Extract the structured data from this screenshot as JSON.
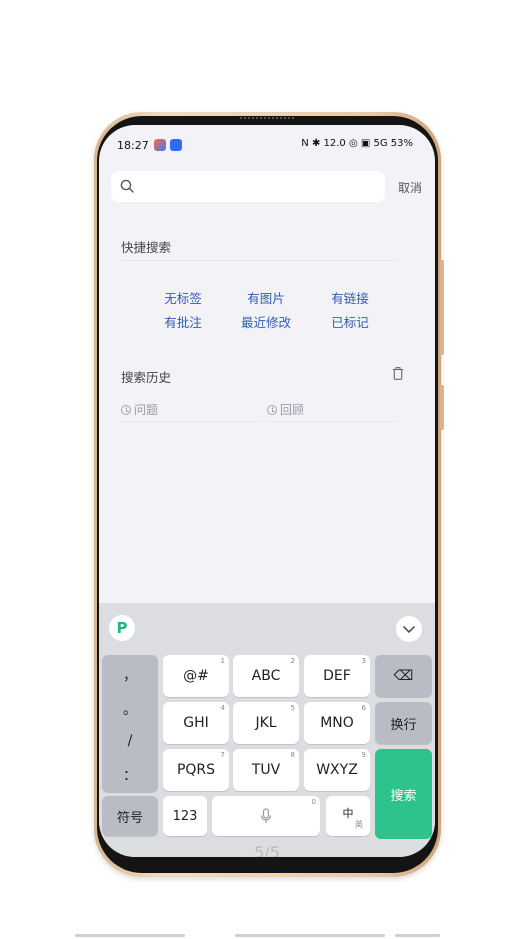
{
  "status_bar": {
    "time": "18:27",
    "right_text": "N ✱ 12.0 ◎ ▣ 5G 53%",
    "battery": "53%"
  },
  "search": {
    "placeholder": "",
    "value": "",
    "cancel_label": "取消"
  },
  "quick_search": {
    "title": "快捷搜索",
    "links": [
      "无标签",
      "有图片",
      "有链接",
      "有批注",
      "最近修改",
      "已标记"
    ]
  },
  "history": {
    "title": "搜索历史",
    "items": [
      "问题",
      "回顾"
    ]
  },
  "keyboard": {
    "logo": "P",
    "punctuation": [
      "，",
      "。",
      "/",
      "："
    ],
    "keys": [
      {
        "label": "@#",
        "sub": "1"
      },
      {
        "label": "ABC",
        "sub": "2"
      },
      {
        "label": "DEF",
        "sub": "3"
      },
      {
        "label": "GHI",
        "sub": "4"
      },
      {
        "label": "JKL",
        "sub": "5"
      },
      {
        "label": "MNO",
        "sub": "6"
      },
      {
        "label": "PQRS",
        "sub": "7"
      },
      {
        "label": "TUV",
        "sub": "8"
      },
      {
        "label": "WXYZ",
        "sub": "9"
      }
    ],
    "delete_label": "⌫",
    "newline_label": "换行",
    "symbol_label": "符号",
    "num_label": "123",
    "space_sub": "0",
    "lang_label": "中",
    "lang_sub": "英",
    "search_label": "搜索"
  },
  "page_indicator": "5/5",
  "colors": {
    "accent_green": "#2cc38d",
    "link_blue": "#2f5cb3",
    "frame_gold": "#e8c9a6"
  }
}
